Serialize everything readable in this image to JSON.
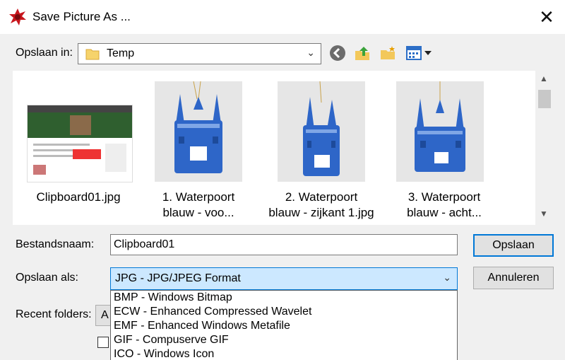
{
  "window": {
    "title": "Save Picture As ...",
    "close_icon": "close-icon"
  },
  "location": {
    "label": "Opslaan in:",
    "folder": "Temp"
  },
  "files": [
    {
      "name_line1": "Clipboard01.jpg",
      "name_line2": ""
    },
    {
      "name_line1": "1. Waterpoort",
      "name_line2": "blauw - voo..."
    },
    {
      "name_line1": "2. Waterpoort",
      "name_line2": "blauw - zijkant 1.jpg"
    },
    {
      "name_line1": "3. Waterpoort",
      "name_line2": "blauw - acht..."
    }
  ],
  "filename": {
    "label": "Bestandsnaam:",
    "value": "Clipboard01"
  },
  "filetype": {
    "label": "Opslaan als:",
    "selected": "JPG - JPG/JPEG Format",
    "options": [
      "BMP - Windows Bitmap",
      "ECW - Enhanced Compressed Wavelet",
      "EMF - Enhanced Windows Metafile",
      "GIF - Compuserve GIF",
      "ICO - Windows Icon"
    ]
  },
  "recent": {
    "label": "Recent folders:",
    "value": "A"
  },
  "buttons": {
    "save": "Opslaan",
    "cancel": "Annuleren"
  },
  "colors": {
    "accent": "#0078d7",
    "selection": "#cce8ff",
    "figurine_blue": "#2e66c8"
  }
}
